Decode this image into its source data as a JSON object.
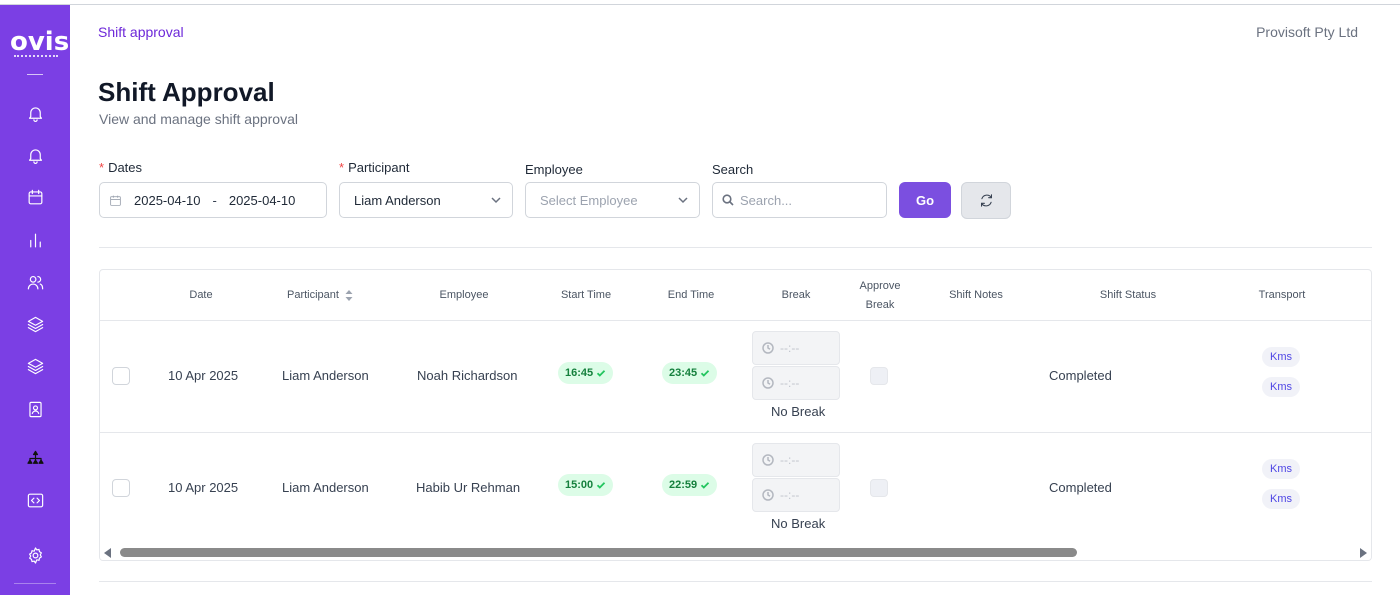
{
  "sidebar": {
    "logo_text": "ovis",
    "icons": [
      "bell-icon",
      "bell-icon",
      "calendar-icon",
      "bar-chart-icon",
      "users-icon",
      "layers-icon",
      "layers-icon",
      "contact-icon",
      "org-chart-icon",
      "code-icon",
      "gear-icon"
    ],
    "accent_color": "#7b3fe4"
  },
  "header": {
    "breadcrumb": "Shift approval",
    "company": "Provisoft Pty Ltd",
    "title": "Shift Approval",
    "subtitle": "View and manage shift approval"
  },
  "filters": {
    "dates_label": "Dates",
    "date_from": "2025-04-10",
    "date_separator": "-",
    "date_to": "2025-04-10",
    "participant_label": "Participant",
    "participant_value": "Liam Anderson",
    "employee_label": "Employee",
    "employee_placeholder": "Select Employee",
    "search_label": "Search",
    "search_placeholder": "Search...",
    "go_label": "Go",
    "required_mark": "*"
  },
  "table": {
    "columns": {
      "date": "Date",
      "participant": "Participant",
      "employee": "Employee",
      "start_time": "Start Time",
      "end_time": "End Time",
      "break": "Break",
      "approve_break_line1": "Approve",
      "approve_break_line2": "Break",
      "shift_notes": "Shift Notes",
      "shift_status": "Shift Status",
      "transport": "Transport"
    },
    "rows": [
      {
        "date": "10 Apr 2025",
        "participant": "Liam Anderson",
        "employee": "Noah Richardson",
        "start_time": "16:45",
        "end_time": "23:45",
        "break_start_placeholder": "--:--",
        "break_end_placeholder": "--:--",
        "break_text": "No Break",
        "shift_status": "Completed",
        "transport_1": "Kms",
        "transport_2": "Kms"
      },
      {
        "date": "10 Apr 2025",
        "participant": "Liam Anderson",
        "employee": "Habib Ur Rehman",
        "start_time": "15:00",
        "end_time": "22:59",
        "break_start_placeholder": "--:--",
        "break_end_placeholder": "--:--",
        "break_text": "No Break",
        "shift_status": "Completed",
        "transport_1": "Kms",
        "transport_2": "Kms"
      }
    ],
    "scroll_position_fraction": 0.0,
    "scroll_visible_fraction": 0.77
  }
}
